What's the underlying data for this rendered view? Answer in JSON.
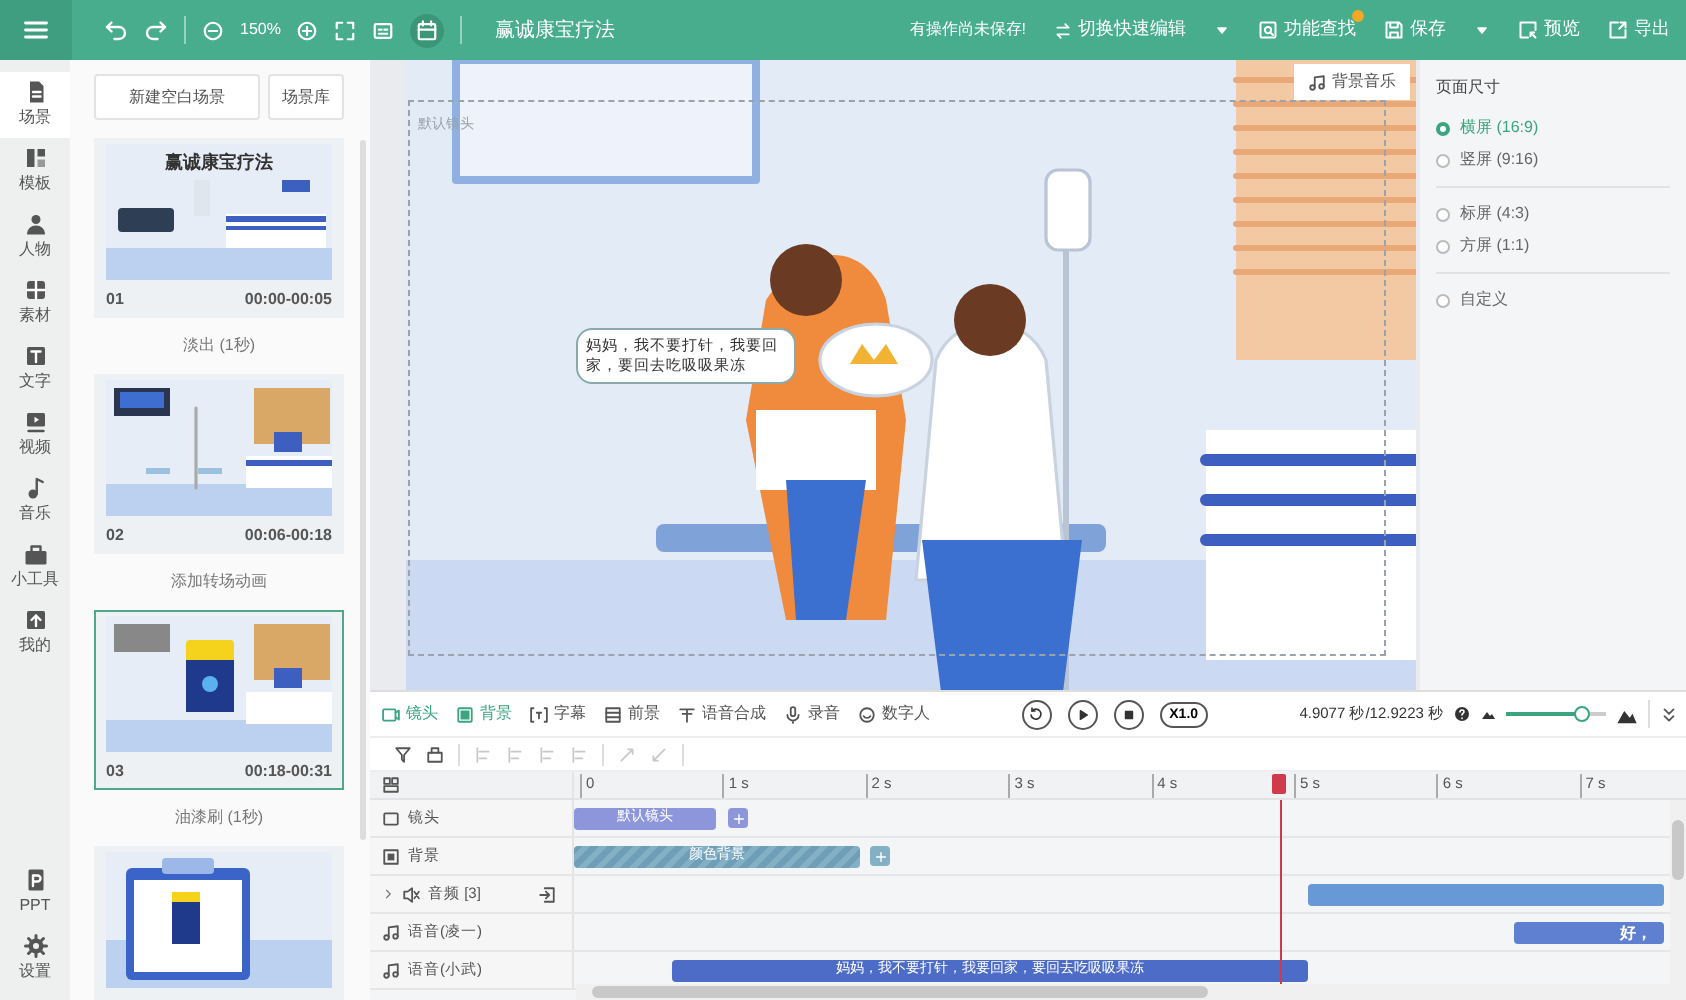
{
  "toolbar": {
    "zoom": "150%",
    "title": "赢诚康宝疗法",
    "unsaved_notice": "有操作尚未保存!",
    "quick_edit": "切换快速编辑",
    "find_feature": "功能查找",
    "find_feature_dot": true,
    "save": "保存",
    "preview": "预览",
    "export": "导出"
  },
  "sidebar": {
    "items": [
      {
        "label": "场景",
        "selected": true
      },
      {
        "label": "模板",
        "selected": false
      },
      {
        "label": "人物",
        "selected": false
      },
      {
        "label": "素材",
        "selected": false
      },
      {
        "label": "文字",
        "selected": false
      },
      {
        "label": "视频",
        "selected": false
      },
      {
        "label": "音乐",
        "selected": false
      },
      {
        "label": "小工具",
        "selected": false
      },
      {
        "label": "我的",
        "selected": false
      }
    ],
    "bottom_items": [
      {
        "label": "PPT",
        "selected": false
      },
      {
        "label": "设置",
        "selected": false
      }
    ]
  },
  "scenes": {
    "new_button": "新建空白场景",
    "library_button": "场景库",
    "items": [
      {
        "kind": "lobby",
        "thumbnail_title": "赢诚康宝疗法",
        "number": "01",
        "time": "00:00-00:05",
        "selected": false,
        "transition": "淡出 (1秒)"
      },
      {
        "kind": "ward",
        "number": "02",
        "time": "00:06-00:18",
        "selected": false,
        "transition": "添加转场动画"
      },
      {
        "kind": "poster",
        "number": "03",
        "time": "00:18-00:31",
        "selected": true,
        "transition": "油漆刷 (1秒)"
      },
      {
        "kind": "clipboard",
        "selected": false
      }
    ]
  },
  "canvas": {
    "camera_label": "默认镜头",
    "bgm_button": "背景音乐",
    "speech_bubble": "妈妈，我不要打针，我要回家，要回去吃吸吸果冻"
  },
  "page_size": {
    "title": "页面尺寸",
    "groups": [
      [
        {
          "label": "横屏 (16:9)",
          "selected": true
        },
        {
          "label": "竖屏 (9:16)",
          "selected": false
        }
      ],
      [
        {
          "label": "标屏 (4:3)",
          "selected": false
        },
        {
          "label": "方屏 (1:1)",
          "selected": false
        }
      ],
      [
        {
          "label": "自定义",
          "selected": false
        }
      ]
    ]
  },
  "timeline": {
    "tools": [
      {
        "label": "镜头",
        "active": true
      },
      {
        "label": "背景",
        "active": true
      },
      {
        "label": "字幕",
        "active": false
      },
      {
        "label": "前景",
        "active": false
      },
      {
        "label": "语音合成",
        "active": false
      },
      {
        "label": "录音",
        "active": false
      },
      {
        "label": "数字人",
        "active": false
      }
    ],
    "speed": "X1.0",
    "time": "4.9077 秒/12.9223 秒",
    "zoom": {
      "level": 0.75
    },
    "ruler": [
      "0",
      "1 s",
      "2 s",
      "3 s",
      "4 s",
      "5 s",
      "6 s",
      "7 s"
    ],
    "tracks": [
      {
        "kind": "camera",
        "label": "镜头",
        "clip": "默认镜头"
      },
      {
        "kind": "background",
        "label": "背景",
        "clip": "颜色背景"
      },
      {
        "kind": "audio",
        "label": "音频 [3]",
        "expanded": false
      },
      {
        "kind": "voice",
        "label": "语音(凌一)",
        "clip": "好，"
      },
      {
        "kind": "voice",
        "label": "语音(小武)",
        "clip": "妈妈，我不要打针，我要回家，要回去吃吸吸果冻"
      }
    ]
  }
}
